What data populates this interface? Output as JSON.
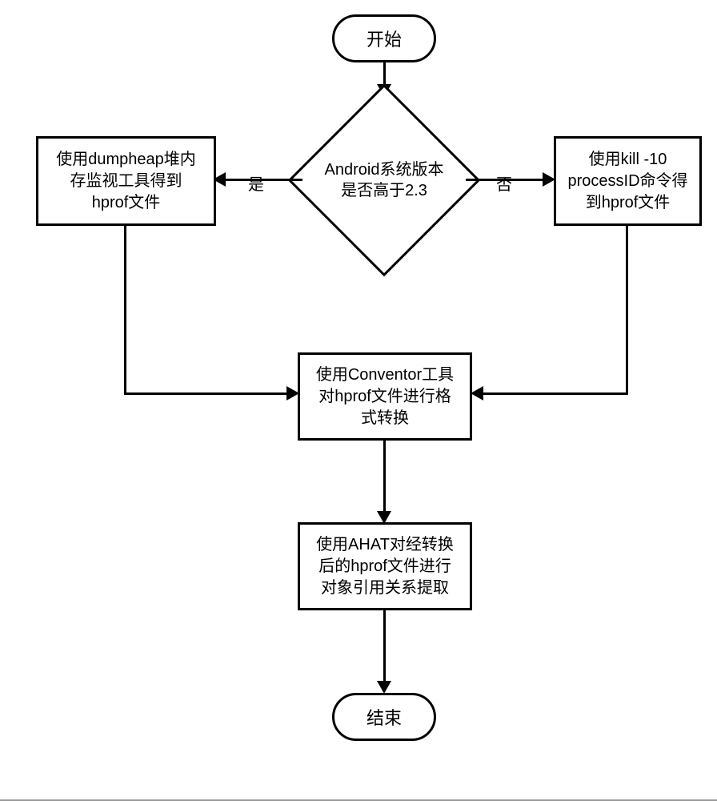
{
  "start": "开始",
  "end": "结束",
  "decision": {
    "line1": "Android系统版本",
    "line2": "是否高于2.3",
    "yes_label": "是",
    "no_label": "否"
  },
  "left_process": {
    "line1": "使用dumpheap堆内",
    "line2": "存监视工具得到",
    "line3": "hprof文件"
  },
  "right_process": {
    "line1": "使用kill -10",
    "line2": "processID命令得",
    "line3": "到hprof文件"
  },
  "convert_process": {
    "line1": "使用Conventor工具",
    "line2": "对hprof文件进行格",
    "line3": "式转换"
  },
  "ahat_process": {
    "line1": "使用AHAT对经转换",
    "line2": "后的hprof文件进行",
    "line3": "对象引用关系提取"
  }
}
